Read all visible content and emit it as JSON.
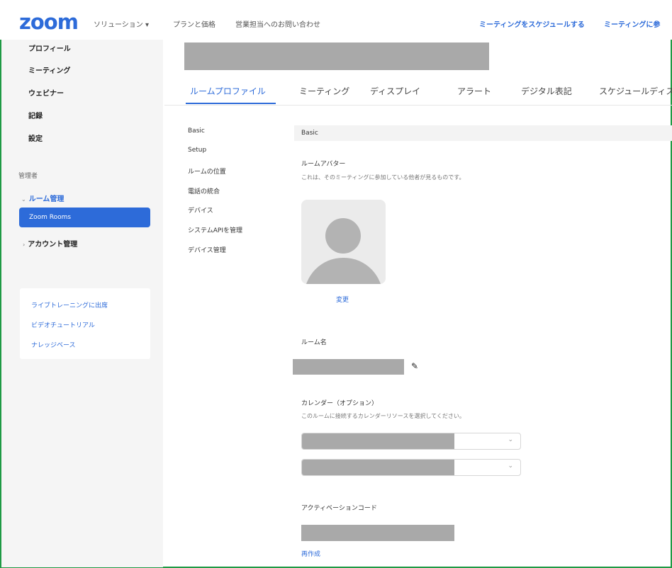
{
  "header": {
    "logo": "zoom",
    "nav": [
      "ソリューション ▾",
      "プランと価格",
      "営業担当へのお問い合わせ"
    ],
    "right_links": [
      "ミーティングをスケジュールする",
      "ミーティングに参"
    ]
  },
  "sidebar": {
    "personal_items": [
      "プロフィール",
      "ミーティング",
      "ウェビナー",
      "記録",
      "設定"
    ],
    "admin_heading": "管理者",
    "room_group": "ルーム管理",
    "active_item": "Zoom Rooms",
    "account_group": "アカウント管理",
    "help_links": [
      "ライブトレーニングに出席",
      "ビデオチュートリアル",
      "ナレッジベース"
    ]
  },
  "tabs": [
    "ルームプロファイル",
    "ミーティング",
    "ディスプレイ",
    "アラート",
    "デジタル表記",
    "スケジュールディス"
  ],
  "subnav": [
    "Basic",
    "Setup",
    "ルームの位置",
    "電話の統合",
    "デバイス",
    "システムAPIを管理",
    "デバイス管理"
  ],
  "basic": {
    "section_title": "Basic",
    "avatar_label": "ルームアバター",
    "avatar_hint": "これは、そのミーティングに参加している他者が見るものです。",
    "change_link": "変更",
    "room_name_label": "ルーム名",
    "calendar_label": "カレンダー（オプション）",
    "calendar_hint": "このルームに接続するカレンダーリソースを選択してください。",
    "activation_label": "アクティベーションコード",
    "regenerate_link": "再作成"
  },
  "colors": {
    "accent": "#2d6bd9",
    "frame": "#1f9a45",
    "redaction": "#a9a9a9"
  }
}
